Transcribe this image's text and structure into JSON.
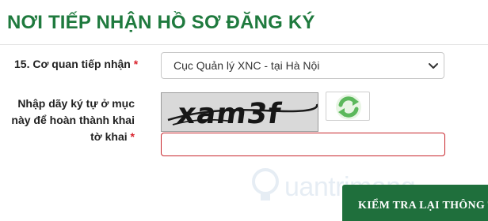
{
  "section": {
    "title": "NƠI TIẾP NHẬN HỒ SƠ ĐĂNG KÝ"
  },
  "agency_field": {
    "label": "15. Cơ quan tiếp nhận",
    "required_mark": "*",
    "selected_value": "Cục Quản lý XNC - tại Hà Nội"
  },
  "captcha_field": {
    "label_line1": "Nhập dãy ký tự ở mục",
    "label_line2": "này để hoàn thành khai",
    "label_line3": "tờ khai",
    "required_mark": "*",
    "captcha_text": "xam3f",
    "input_value": "",
    "refresh_icon": "refresh-icon"
  },
  "watermark": {
    "text": "uantrimang"
  },
  "actions": {
    "check_label": "KIỂM TRA LẠI THÔNG T"
  },
  "colors": {
    "title_green": "#1f7a3e",
    "button_green": "#1f6f3c",
    "required_red": "#d9232d",
    "error_border": "#c8262c",
    "refresh_green": "#5cb85c"
  }
}
